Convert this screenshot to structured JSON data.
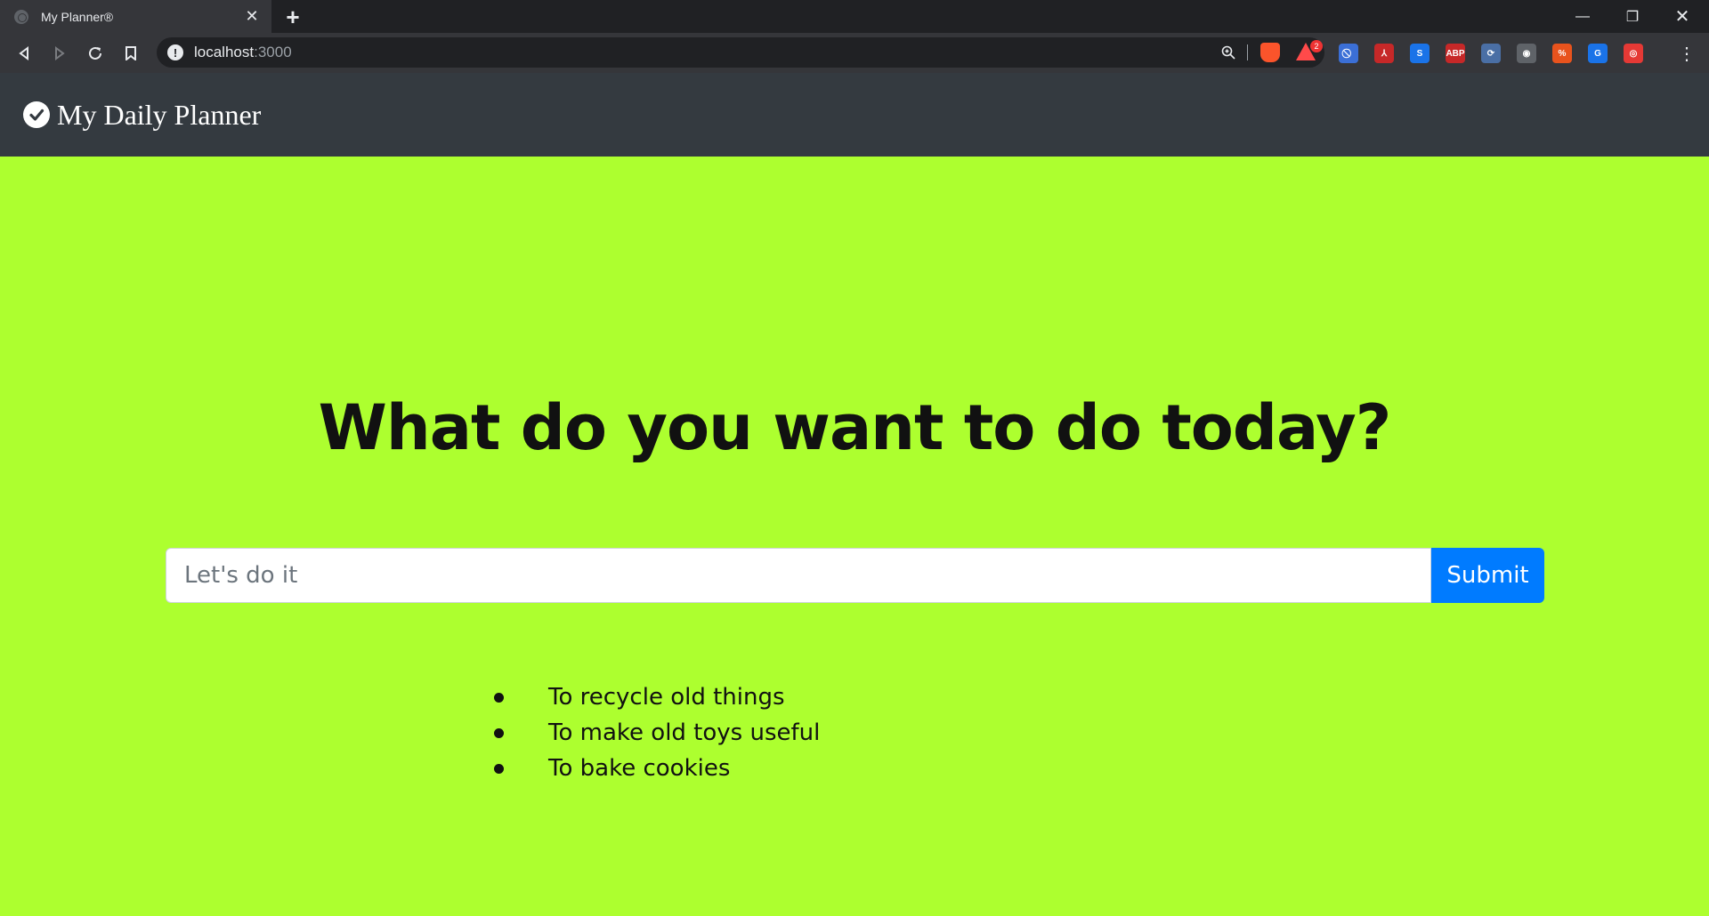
{
  "browser": {
    "tab": {
      "title": "My Planner®",
      "close": "✕"
    },
    "new_tab": "+",
    "window_controls": {
      "minimize": "—",
      "maximize": "❐",
      "close": "✕"
    },
    "address": {
      "host": "localhost",
      "port": ":3000"
    },
    "rewards_badge": "2",
    "extensions": [
      {
        "name": "block-icon",
        "color": "#3b6fd6",
        "glyph": "⃠"
      },
      {
        "name": "pdf-icon",
        "color": "#c62828",
        "glyph": "⅄"
      },
      {
        "name": "s-extension-icon",
        "color": "#1a73e8",
        "glyph": "S"
      },
      {
        "name": "adblock-plus-icon",
        "color": "#c62828",
        "glyph": "ABP"
      },
      {
        "name": "sync-icon",
        "color": "#4a6fa5",
        "glyph": "⟳"
      },
      {
        "name": "camera-icon",
        "color": "#5f6368",
        "glyph": "◉"
      },
      {
        "name": "percent-icon",
        "color": "#e8531d",
        "glyph": "%"
      },
      {
        "name": "translate-icon",
        "color": "#1a73e8",
        "glyph": "G"
      },
      {
        "name": "notification-icon",
        "color": "#e53935",
        "glyph": "◎"
      }
    ],
    "menu": "⋮"
  },
  "app": {
    "brand": "My Daily Planner",
    "heading": "What do you want to do today?",
    "input": {
      "placeholder": "Let's do it",
      "value": ""
    },
    "submit_label": "Submit",
    "todos": [
      "To recycle old things",
      "To make old toys useful",
      "To bake cookies"
    ]
  },
  "colors": {
    "page_bg": "#adff2f",
    "navbar_bg": "#343a40",
    "button_bg": "#007bff"
  }
}
